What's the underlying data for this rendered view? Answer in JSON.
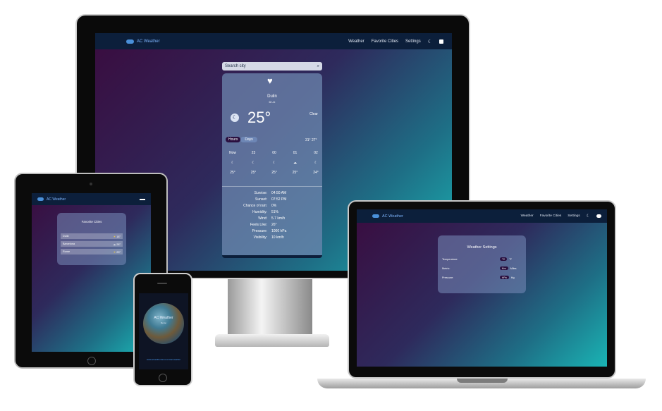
{
  "brand": "AC Weather",
  "nav": {
    "weather": "Weather",
    "favorites": "Favorite Cities",
    "settings": "Settings"
  },
  "search": {
    "placeholder": "Search city"
  },
  "weather_card": {
    "city": "Dulin",
    "sub": "Dr-rx",
    "temp": "25°",
    "condition": "Clear",
    "tab_hours": "Hours",
    "tab_days": "Days",
    "range": "31° 27°",
    "hours": [
      {
        "time": "Now",
        "temp": "25°"
      },
      {
        "time": "23",
        "temp": "25°"
      },
      {
        "time": "00",
        "temp": "25°"
      },
      {
        "time": "01",
        "temp": "25°"
      },
      {
        "time": "02",
        "temp": "24°"
      }
    ],
    "details": [
      {
        "label": "Sunrise:",
        "value": "04:50 AM"
      },
      {
        "label": "Sunset:",
        "value": "07:52 PM"
      },
      {
        "label": "Chance of rain:",
        "value": "0%"
      },
      {
        "label": "Humidity:",
        "value": "51%"
      },
      {
        "label": "Wind:",
        "value": "5.7 km/h"
      },
      {
        "label": "Feels Like:",
        "value": "26°"
      },
      {
        "label": "Pressure:",
        "value": "1000 hPa"
      },
      {
        "label": "Visibility:",
        "value": "10 km/h"
      }
    ]
  },
  "favorites": {
    "title": "Favorite Cities",
    "cities": [
      {
        "name": "Dulin",
        "temp": "18°"
      },
      {
        "name": "Barcelona",
        "temp": "28°"
      },
      {
        "name": "Rome",
        "temp": "23°"
      }
    ]
  },
  "phone": {
    "title": "AC Weather",
    "sub": "Demo",
    "link": "www.acweather.demo.com/ac-weather"
  },
  "settings": {
    "title": "Weather Settings",
    "rows": [
      {
        "label": "Temperature:",
        "left": "°C",
        "right": "°F"
      },
      {
        "label": "Metric:",
        "left": "Km",
        "right": "Miles"
      },
      {
        "label": "Pressure:",
        "left": "hPa",
        "right": "Hg"
      }
    ]
  }
}
